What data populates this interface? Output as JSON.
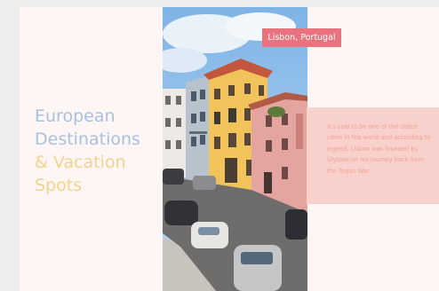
{
  "slide": {
    "title_line1": "European",
    "title_line2": "Destinations",
    "title_line3": "& Vacation",
    "title_line4": "Spots",
    "location_tag": "Lisbon, Portugal",
    "quote": "It's said to be one of the oldest cities in the world and according to legend, Lisbon was founded by Ulysses on his journey back from the Trojan War."
  },
  "colors": {
    "card_background": "#fdf6f4",
    "title_blue": "#a9c1de",
    "title_yellow": "#f2d28d",
    "tag_background": "#e8737f",
    "quote_background": "#f8d1cc",
    "quote_text": "#f4a296"
  }
}
